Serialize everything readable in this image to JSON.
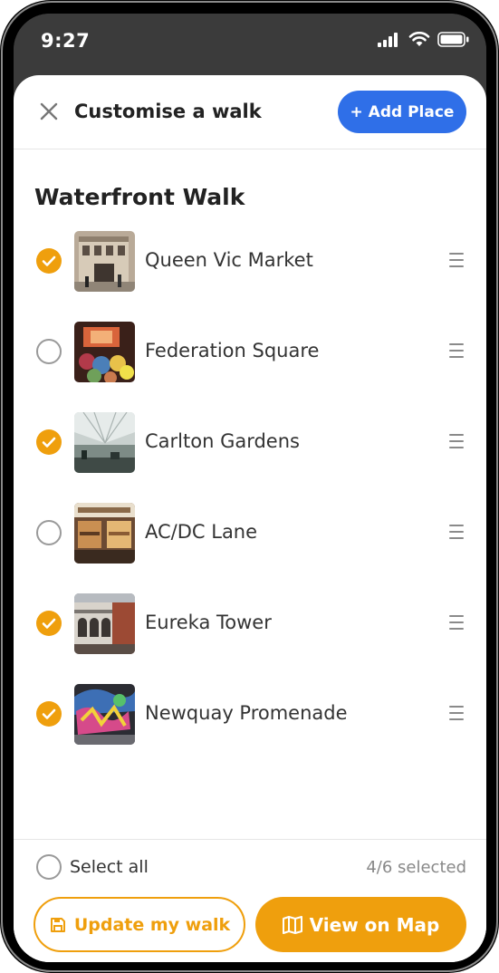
{
  "status_bar": {
    "time": "9:27"
  },
  "header": {
    "title": "Customise a walk",
    "add_place_label": "+ Add Place"
  },
  "walk": {
    "title": "Waterfront Walk"
  },
  "places": [
    {
      "name": "Queen Vic Market",
      "selected": true,
      "thumbnail": "building-facade-photo"
    },
    {
      "name": "Federation Square",
      "selected": false,
      "thumbnail": "crowd-event-photo"
    },
    {
      "name": "Carlton Gardens",
      "selected": true,
      "thumbnail": "glass-atrium-photo"
    },
    {
      "name": "AC/DC Lane",
      "selected": false,
      "thumbnail": "shopfront-photo"
    },
    {
      "name": "Eureka Tower",
      "selected": true,
      "thumbnail": "brick-arcade-photo"
    },
    {
      "name": "Newquay Promenade",
      "selected": true,
      "thumbnail": "graffiti-wall-photo"
    }
  ],
  "footer": {
    "select_all_label": "Select all",
    "selected_count": "4/6 selected",
    "update_label": "Update my walk",
    "map_label": "View on Map"
  },
  "colors": {
    "accent": "#ef9f0d",
    "primary": "#2f6fe8"
  }
}
